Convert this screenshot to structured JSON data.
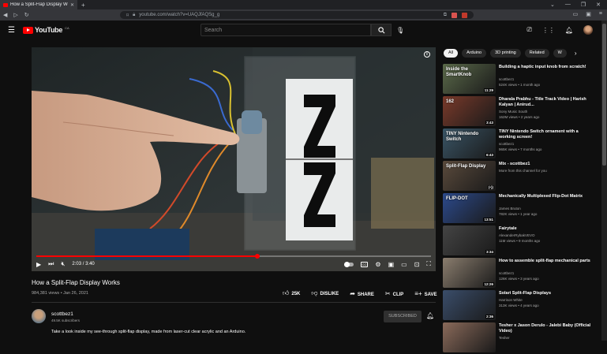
{
  "browser": {
    "tab_title": "How a Split-Flap Display Works",
    "url": "youtube.com/watch?v=UAQJfAQSg_g"
  },
  "youtube": {
    "brand": "YouTube",
    "country": "CA",
    "search_placeholder": "Search"
  },
  "player": {
    "time": "2:03 / 3:40",
    "progress_fraction": 0.56
  },
  "video": {
    "title": "How a Split-Flap Display Works",
    "views_date": "984,381 views • Jan 26, 2021",
    "likes": "25K",
    "dislike": "DISLIKE",
    "share": "SHARE",
    "clip": "CLIP",
    "save": "SAVE"
  },
  "channel": {
    "name": "scottbez1",
    "subs": "49.5K subscribers",
    "subscribe": "SUBSCRIBED",
    "description": "Take a look inside my see-through split-flap display, made from laser-cut clear acrylic and an Arduino."
  },
  "chips": [
    "All",
    "Arduino",
    "3D printing",
    "Related",
    "W"
  ],
  "recs": [
    {
      "title": "Building a haptic input knob from scratch!",
      "channel": "scottbez1",
      "meta": "524K views • 1 month ago",
      "dur": "11:29",
      "thumb_text": "Inside the SmartKnob",
      "bg": "#5b6a4a"
    },
    {
      "title": "Dharala Prabhu - Title Track Video | Harish Kalyan | Anirud...",
      "channel": "Sony Music South",
      "meta": "162M views • 2 years ago",
      "dur": "3:43",
      "thumb_text": "162",
      "bg": "#7a3a2a"
    },
    {
      "title": "TINY Nintendo Switch ornament with a working screen!",
      "channel": "scottbez1",
      "meta": "965K views • 7 months ago",
      "dur": "6:43",
      "thumb_text": "TINY Nintendo Switch",
      "bg": "#3a5566"
    },
    {
      "title": "Mix - scottbez1",
      "channel": "More from this channel for you",
      "meta": "",
      "dur": "(•))",
      "thumb_text": "Split-Flap Display",
      "bg": "#5a4a3c"
    },
    {
      "title": "Mechanically Multiplexed Flip-Dot Matrix",
      "channel": "James Bruton",
      "meta": "782K views • 1 year ago",
      "dur": "13:51",
      "thumb_text": "FLIP-DOT",
      "bg": "#2c4a8c"
    },
    {
      "title": "Fairytale",
      "channel": "AlexanderRybakVEVO",
      "meta": "11M views • 9 months ago",
      "dur": "3:34",
      "thumb_text": "",
      "bg": "#444444"
    },
    {
      "title": "How to assemble split-flap mechanical parts",
      "channel": "scottbez1",
      "meta": "126K views • 3 years ago",
      "dur": "12:26",
      "thumb_text": "",
      "bg": "#8a7d6e"
    },
    {
      "title": "Solari Split-Flap Displays",
      "channel": "Harrison White",
      "meta": "313K views • 4 years ago",
      "dur": "2:36",
      "thumb_text": "",
      "bg": "#3a4d6a"
    },
    {
      "title": "Tesher x Jason Derulo - Jalebi Baby (Official Video)",
      "channel": "Tesher",
      "meta": "",
      "dur": "",
      "thumb_text": "",
      "bg": "#8a6a5a"
    }
  ],
  "colors": {
    "accent": "#ff0000",
    "bg": "#0f0f0f"
  }
}
